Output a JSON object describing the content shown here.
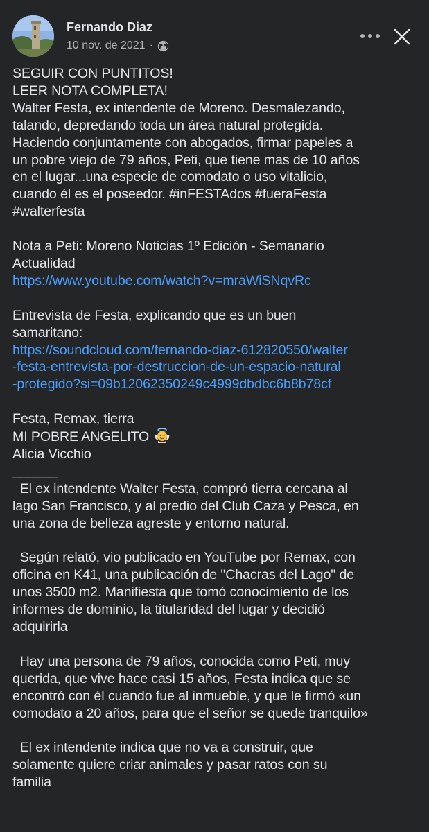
{
  "header": {
    "author": "Fernando Diaz",
    "date": "10 nov. de 2021",
    "visibility_icon": "globe-icon",
    "more_icon": "more-options-icon",
    "close_icon": "close-icon"
  },
  "post": {
    "p1_l1": "SEGUIR CON PUNTITOS!",
    "p1_l2": "LEER NOTA COMPLETA!",
    "p1_l3": "Walter Festa, ex intendente de Moreno. Desmalezando,",
    "p1_l4": "talando, depredando toda un área natural protegida.",
    "p1_l5": "Haciendo conjuntamente con abogados, firmar papeles a",
    "p1_l6": "un pobre viejo de 79 años, Peti, que tiene mas de 10 años",
    "p1_l7": "en el lugar...una especie de comodato o uso vitalicio,",
    "p1_l8": "cuando él es el poseedor. #inFESTAdos #fueraFesta",
    "p1_l9": "#walterfesta",
    "p2_l1": "Nota a Peti: Moreno Noticias 1º Edición - Semanario",
    "p2_l2": "Actualidad",
    "link1": "https://www.youtube.com/watch?v=mraWiSNqvRc",
    "p3_l1": "Entrevista de Festa, explicando que es un buen",
    "p3_l2": "samaritano:",
    "link2_l1": "https://soundcloud.com/fernando-diaz-612820550/walter",
    "link2_l2": "-festa-entrevista-por-destruccion-de-un-espacio-natural",
    "link2_l3": "-protegido?si=09b12062350249c4999dbdbc6b8b78cf",
    "p4_l1": "Festa, Remax, tierra",
    "p4_l2": "MI POBRE ANGELITO",
    "p4_l3": "Alicia Vicchio",
    "p4_l4": "______",
    "p5_l1": "  El ex intendente Walter Festa, compró tierra cercana al",
    "p5_l2": "lago San Francisco, y al predio del Club Caza y Pesca, en",
    "p5_l3": "una zona de belleza agreste y entorno natural.",
    "p6_l1": "  Según relató, vio publicado en YouTube por Remax, con",
    "p6_l2": "oficina en K41, una publicación de \"Chacras del Lago\" de",
    "p6_l3": "unos 3500 m2. Manifiesta que tomó conocimiento de los",
    "p6_l4": "informes de dominio, la titularidad del lugar y decidió",
    "p6_l5": "adquirirla",
    "p7_l1": "  Hay una persona de 79 años, conocida como Peti, muy",
    "p7_l2": "querida, que vive hace casi 15 años, Festa indica que se",
    "p7_l3": "encontró con él cuando fue al inmueble, y que le firmó «un",
    "p7_l4": "comodato a 20 años, para que el señor se quede tranquilo»",
    "p8_l1": "  El ex intendente indica que no va a construir, que",
    "p8_l2": "solamente quiere criar animales y pasar ratos con su",
    "p8_l3": "familia"
  },
  "colors": {
    "background": "#242526",
    "text": "#e4e6eb",
    "secondary_text": "#b0b3b8",
    "link": "#4a9eff"
  }
}
